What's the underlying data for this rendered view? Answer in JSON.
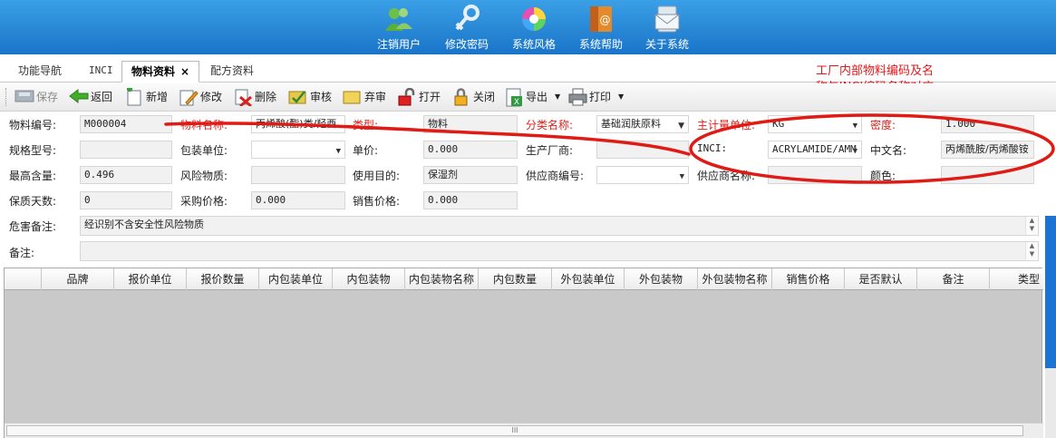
{
  "top_menu": [
    {
      "label": "注销用户",
      "icon": "users-icon"
    },
    {
      "label": "修改密码",
      "icon": "key-icon"
    },
    {
      "label": "系统风格",
      "icon": "palette-icon"
    },
    {
      "label": "系统帮助",
      "icon": "help-book-icon"
    },
    {
      "label": "关于系统",
      "icon": "about-mail-icon"
    }
  ],
  "tabs": [
    {
      "label": "功能导航"
    },
    {
      "label": "INCI"
    },
    {
      "label": "物料资料",
      "close": "×"
    },
    {
      "label": "配方资料"
    }
  ],
  "annotation": {
    "line1": "工厂内部物料编码及名",
    "line2": "称与INCI编码名称对应",
    "color": "#e6161a"
  },
  "toolbar": {
    "save": "保存",
    "back": "返回",
    "add": "新增",
    "edit": "修改",
    "delete": "删除",
    "review": "审核",
    "abandon": "弃审",
    "open": "打开",
    "close": "关闭",
    "export": "导出",
    "print": "打印"
  },
  "form": {
    "material_code_label": "物料编号:",
    "material_code": "M000004",
    "material_name_label": "物料名称:",
    "material_name": "丙烯酸(酯)类/羟酉",
    "type_label": "类型:",
    "type": "物料",
    "category_label": "分类名称:",
    "category": "基础润肤原料",
    "unit_label": "主计量单位:",
    "unit": "KG",
    "density_label": "密度:",
    "density": "1.000",
    "spec_label": "规格型号:",
    "spec": "",
    "pack_unit_label": "包装单位:",
    "pack_unit": "",
    "price_label": "单价:",
    "price": "0.000",
    "manufacturer_label": "生产厂商:",
    "manufacturer": "",
    "inci_label": "INCI:",
    "inci": "ACRYLAMIDE/AMM",
    "cn_name_label": "中文名:",
    "cn_name": "丙烯酰胺/丙烯酸铵",
    "max_content_label": "最高含量:",
    "max_content": "0.496",
    "risk_label": "风险物质:",
    "risk": "",
    "purpose_label": "使用目的:",
    "purpose": "保湿剂",
    "supplier_code_label": "供应商编号:",
    "supplier_code": "",
    "supplier_name_label": "供应商名称:",
    "supplier_name": "",
    "color_label": "颜色:",
    "color": "",
    "shelf_days_label": "保质天数:",
    "shelf_days": "0",
    "purchase_price_label": "采购价格:",
    "purchase_price": "0.000",
    "sale_price_label": "销售价格:",
    "sale_price": "0.000",
    "hazard_label": "危害备注:",
    "hazard": "经识别不含安全性风险物质",
    "remark_label": "备注:",
    "remark": ""
  },
  "grid": {
    "columns": [
      "品牌",
      "报价单位",
      "报价数量",
      "内包装单位",
      "内包装物",
      "内包装物名称",
      "内包数量",
      "外包装单位",
      "外包装物",
      "外包装物名称",
      "销售价格",
      "是否默认",
      "备注",
      "类型"
    ],
    "scroll_grip": "III"
  }
}
